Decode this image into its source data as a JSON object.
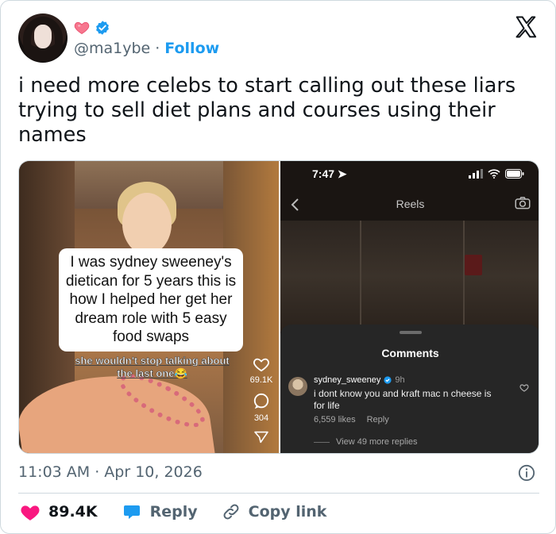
{
  "author": {
    "handle": "@ma1ybe",
    "follow_label": "Follow",
    "separator": "·"
  },
  "tweet": {
    "text": "i need more celebs to start calling out these liars trying to sell diet plans and courses using their names",
    "timestamp": "11:03 AM · Apr 10, 2026"
  },
  "media": {
    "left": {
      "caption": "I was sydney sweeney's dietican for 5 years this is how I helped her get her dream role with 5 easy food swaps",
      "sub_caption": "she wouldn't stop talking about the last one😂",
      "likes": "69.1K",
      "comments": "304"
    },
    "right": {
      "time": "7:47",
      "header": "Reels",
      "sheet_title": "Comments",
      "comment": {
        "user": "sydney_sweeney",
        "age": "9h",
        "text": "i dont know you and kraft mac n cheese is for life",
        "likes": "6,559 likes",
        "reply": "Reply",
        "more": "View 49 more replies"
      }
    }
  },
  "actions": {
    "like_count": "89.4K",
    "reply_label": "Reply",
    "copy_label": "Copy link"
  },
  "colors": {
    "accent": "#1d9bf0",
    "like": "#f91880",
    "secondary": "#536471"
  },
  "icons": [
    "pink-heart-icon",
    "verified-badge-icon",
    "x-logo-icon",
    "info-icon",
    "heart-icon",
    "reply-bubble-icon",
    "link-icon"
  ]
}
